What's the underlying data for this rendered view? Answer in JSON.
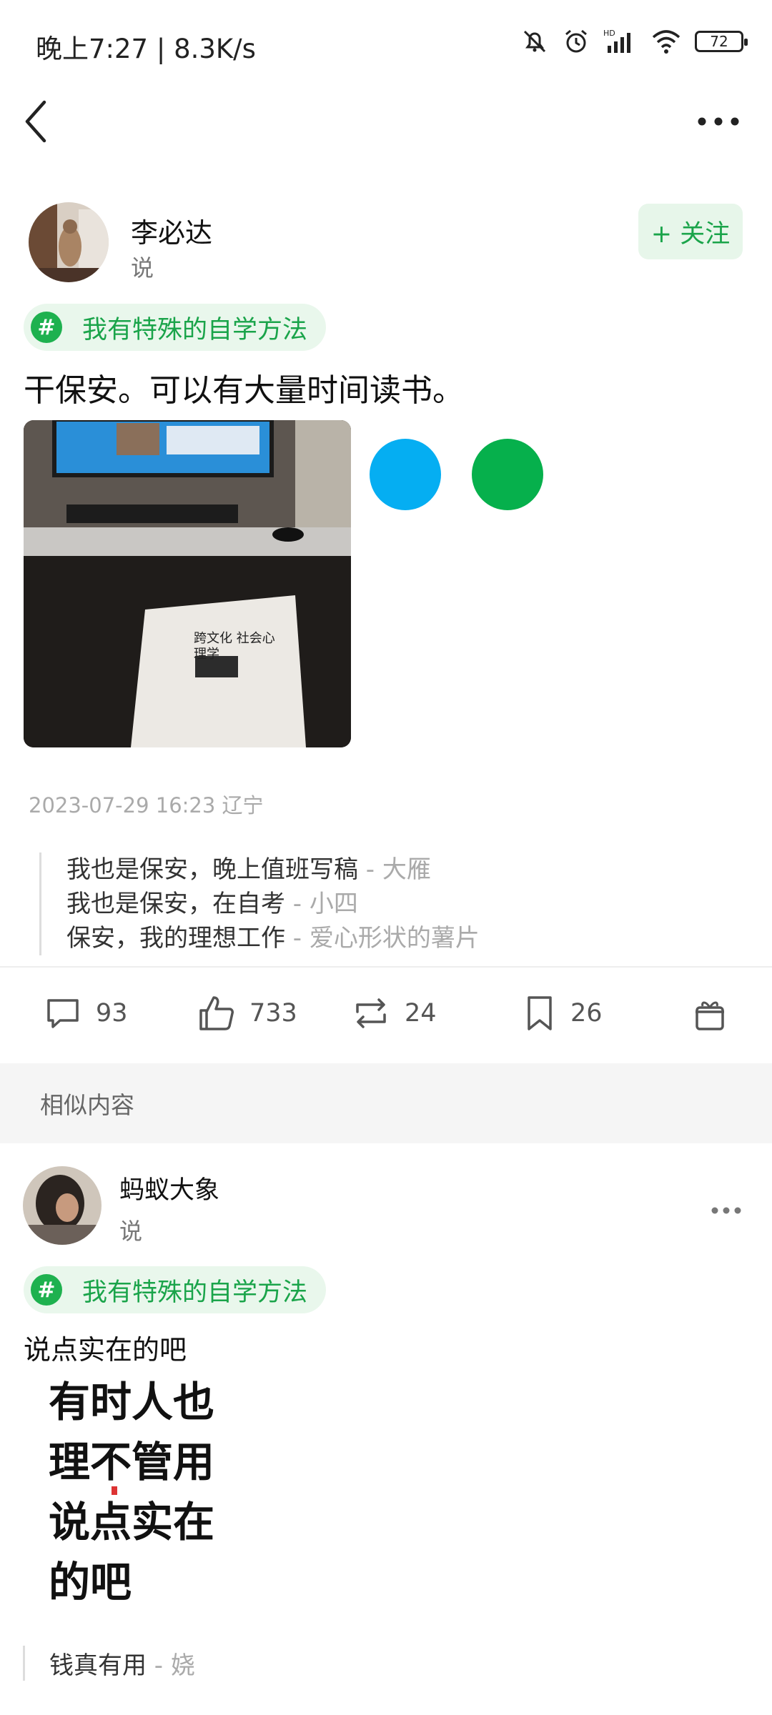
{
  "status_bar": {
    "time": "晚上7:27 | 8.3K/s",
    "battery": "72",
    "icons": [
      "mute-bell-icon",
      "alarm-icon",
      "signal-icon",
      "wifi-icon",
      "battery-icon"
    ]
  },
  "nav": {
    "back_icon": "chevron-left-icon",
    "more_icon": "more-dots-icon"
  },
  "post": {
    "author": "李必达",
    "subtitle": "说",
    "follow_label": "+ 关注",
    "topic": "我有特殊的自学方法",
    "text": "干保安。可以有大量时间读书。",
    "meta": "2023-07-29 16:23 辽宁",
    "book_title": "跨文化 社会心理学",
    "comments": [
      {
        "text": "我也是保安，晚上值班写稿",
        "author": " - 大雁"
      },
      {
        "text": "我也是保安，在自考",
        "author": " - 小四"
      },
      {
        "text": "保安，我的理想工作",
        "author": " - 爱心形状的薯片"
      }
    ],
    "stats": {
      "comments": "93",
      "likes": "733",
      "reposts": "24",
      "saves": "26"
    },
    "colors": {
      "accent": "#1aa44a",
      "dot_blue": "#05aef2",
      "dot_green": "#06b04c"
    }
  },
  "similar": {
    "label": "相似内容",
    "post": {
      "author": "蚂蚁大象",
      "subtitle": "说",
      "topic": "我有特殊的自学方法",
      "text": "说点实在的吧",
      "calligraphy": [
        "有时人也",
        "理不管用",
        "说点实在",
        "的吧"
      ],
      "comment": {
        "text": "钱真有用",
        "author": " - 娆"
      }
    }
  }
}
